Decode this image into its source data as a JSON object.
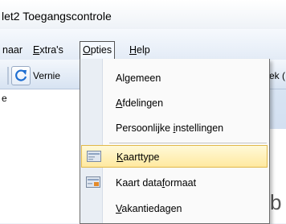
{
  "window": {
    "title": "let2 Toegangscontrole"
  },
  "menubar": {
    "items": [
      {
        "label_pre": "",
        "label_u": "",
        "label_post": "naar"
      },
      {
        "label_pre": "",
        "label_u": "E",
        "label_post": "xtra's"
      },
      {
        "label_pre": "",
        "label_u": "O",
        "label_post": "pties"
      },
      {
        "label_pre": "",
        "label_u": "H",
        "label_post": "elp"
      }
    ]
  },
  "toolbar": {
    "refresh_label": "Vernie",
    "right_label": "ek ("
  },
  "content": {
    "left_text": "e",
    "right_big": "b"
  },
  "dropdown": {
    "items": [
      {
        "pre": "Al",
        "u": "g",
        "post": "emeen"
      },
      {
        "pre": "",
        "u": "A",
        "post": "fdelingen"
      },
      {
        "pre": "Persoonlijke ",
        "u": "i",
        "post": "nstellingen"
      },
      {
        "pre": "",
        "u": "K",
        "post": "aarttype"
      },
      {
        "pre": "Kaart data",
        "u": "f",
        "post": "ormaat"
      },
      {
        "pre": "",
        "u": "V",
        "post": "akantiedagen"
      }
    ]
  }
}
